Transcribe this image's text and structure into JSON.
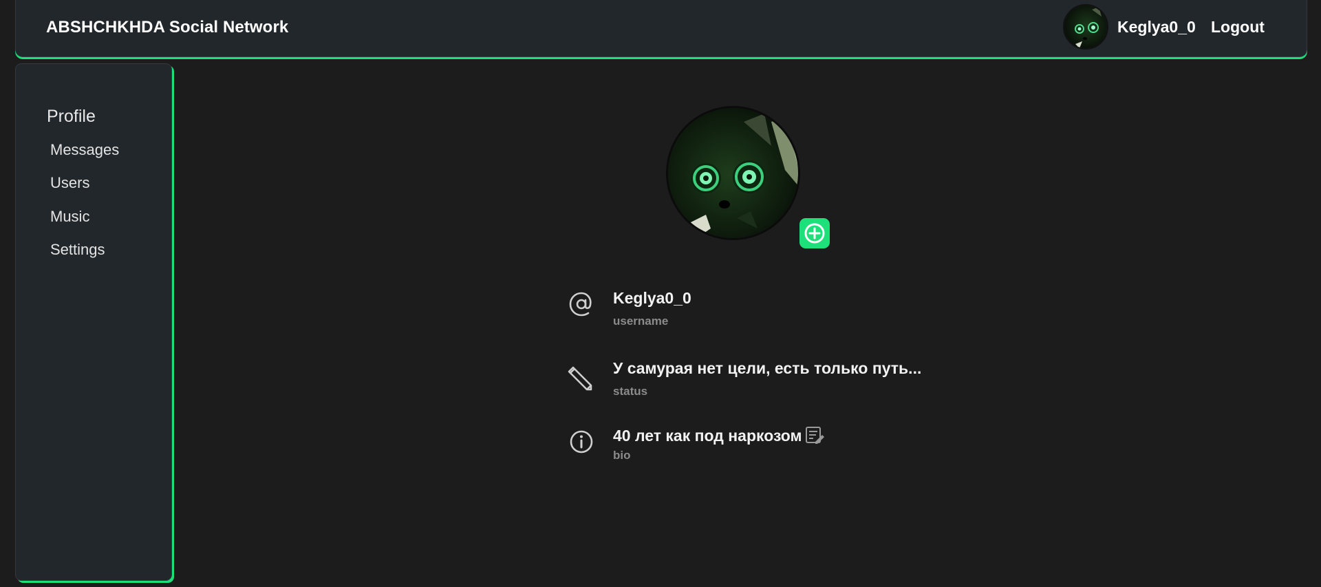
{
  "header": {
    "brand": "ABSHCHKHDA Social Network",
    "username": "Keglya0_0",
    "logout_label": "Logout",
    "avatar_icon": "cat-avatar"
  },
  "sidebar": {
    "title": "Profile",
    "items": [
      {
        "label": "Messages"
      },
      {
        "label": "Users"
      },
      {
        "label": "Music"
      },
      {
        "label": "Settings"
      }
    ]
  },
  "profile": {
    "avatar_icon": "cat-avatar",
    "add_photo_icon": "plus-circle-icon",
    "fields": [
      {
        "icon": "at-sign-icon",
        "value": "Keglya0_0",
        "label": "username"
      },
      {
        "icon": "pencil-icon",
        "value": "У самурая нет цели, есть только путь...",
        "label": "status"
      },
      {
        "icon": "info-icon",
        "value": "40 лет как под наркозом",
        "label": "bio"
      }
    ],
    "edit_bio_icon": "edit-note-icon"
  },
  "colors": {
    "accent": "#1ee07a",
    "background": "#1c1c1c",
    "panel": "#22272b",
    "label": "#8b8b8b"
  }
}
